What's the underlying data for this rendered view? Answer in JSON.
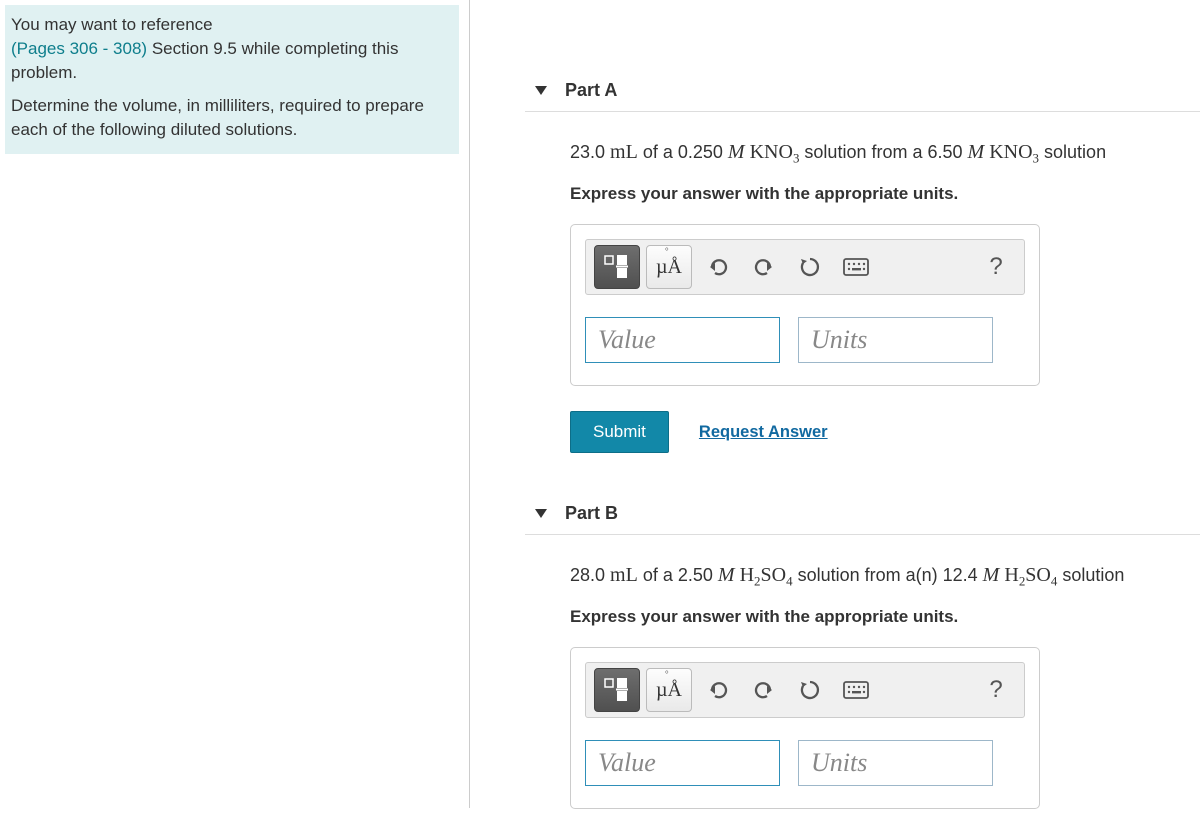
{
  "hint": {
    "line1": "You may want to reference",
    "pages": "(Pages 306 - 308)",
    "line1b": " Section 9.5 while completing this problem.",
    "line2": "Determine the volume, in milliliters, required to prepare each of the following diluted solutions."
  },
  "parts": {
    "a": {
      "title": "Part A",
      "raw_prompt": "23.0 mL of a 0.250 M KNO3 solution from a 6.50 M KNO3 solution",
      "q_pre": "23.0 ",
      "q_unit1": "mL",
      "q_mid1": " of a 0.250 ",
      "q_M1": "M",
      "q_sp1": "  ",
      "q_chem1_a": "KNO",
      "q_chem1_sub": "3",
      "q_mid2": " solution from a 6.50 ",
      "q_M2": "M",
      "q_sp2": " ",
      "q_chem2_a": "KNO",
      "q_chem2_sub": "3",
      "q_end": " solution",
      "instruction": "Express your answer with the appropriate units."
    },
    "b": {
      "title": "Part B",
      "raw_prompt": "28.0 mL of a 2.50 M H2SO4 solution from a(n) 12.4 M H2SO4 solution",
      "q_pre": "28.0 ",
      "q_unit1": "mL",
      "q_mid1": " of a 2.50 ",
      "q_M1": "M",
      "q_sp1": "  ",
      "q_chem1_a": "H",
      "q_chem1_sub1": "2",
      "q_chem1_b": "SO",
      "q_chem1_sub2": "4",
      "q_mid2": " solution from a(n) 12.4 ",
      "q_M2": "M",
      "q_sp2": " ",
      "q_chem2_a": "H",
      "q_chem2_sub1": "2",
      "q_chem2_b": "SO",
      "q_chem2_sub2": "4",
      "q_end": " solution",
      "instruction": "Express your answer with the appropriate units."
    }
  },
  "toolbar": {
    "ua_label": "µÅ",
    "help_label": "?"
  },
  "inputs": {
    "value_placeholder": "Value",
    "units_placeholder": "Units"
  },
  "actions": {
    "submit": "Submit",
    "request": "Request Answer"
  }
}
